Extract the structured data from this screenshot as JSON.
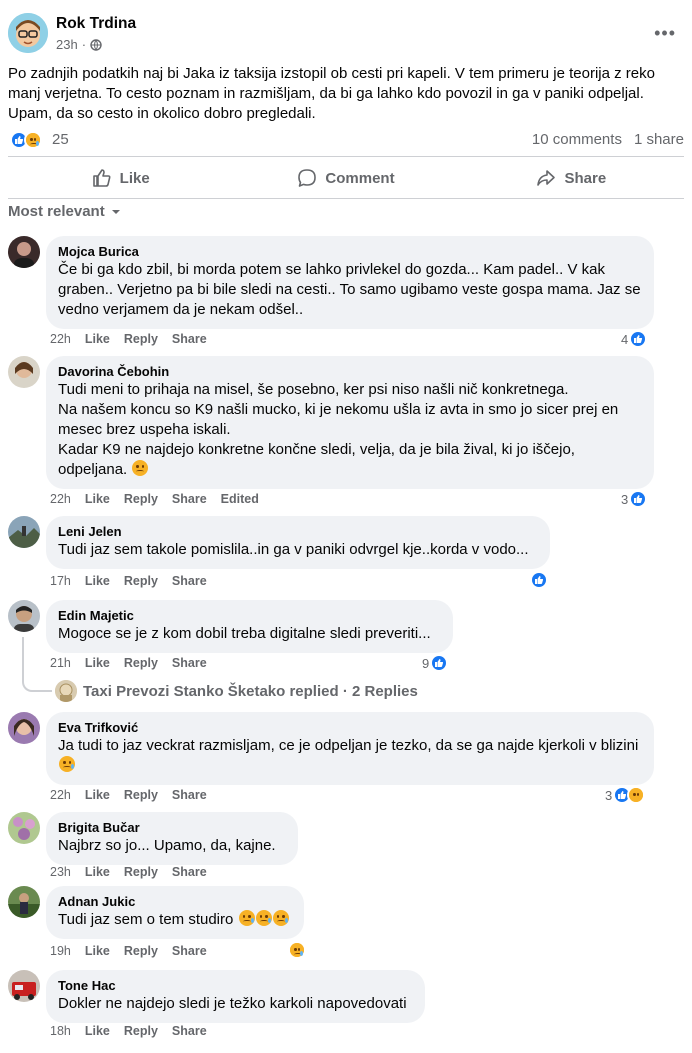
{
  "post": {
    "author": "Rok Trdina",
    "time": "23h",
    "privacy_icon": "globe-icon",
    "text": "Po zadnjih podatkih naj bi Jaka iz taksija izstopil ob cesti pri kapeli. V tem primeru je teorija z reko manj verjetna. To cesto poznam in razmišljam, da bi ga lahko kdo povozil in ga v paniki odpeljal. Upam, da so cesto in okolico dobro pregledali.",
    "reaction_count": "25",
    "comments_count": "10 comments",
    "shares_count": "1 share"
  },
  "actions": {
    "like": "Like",
    "comment": "Comment",
    "share": "Share"
  },
  "sort_label": "Most relevant",
  "comment_actions": {
    "like": "Like",
    "reply": "Reply",
    "share": "Share",
    "edited": "Edited"
  },
  "comments": [
    {
      "name": "Mojca Burica",
      "text": "Če bi ga kdo zbil, bi morda potem se lahko privlekel do gozda... Kam padel.. V kak graben.. Verjetno pa bi bile sledi na cesti.. To samo ugibamo veste gospa mama. Jaz se vedno verjamem da je nekam odšel..",
      "time": "22h",
      "reactions": "4"
    },
    {
      "name": "Davorina Čebohin",
      "text": "Tudi meni to prihaja na misel, še posebno, ker psi niso našli nič konkretnega.\nNa našem koncu so K9 našli mucko, ki je nekomu ušla iz avta in smo jo sicer prej en mesec brez uspeha iskali.\nKadar K9 ne najdejo konkretne končne sledi, velja, da je bila žival, ki jo iščejo, odpeljana.",
      "time": "22h",
      "reactions": "3"
    },
    {
      "name": "Leni Jelen",
      "text": "Tudi jaz sem takole pomislila..in ga v paniki odvrgel kje..korda v vodo...",
      "time": "17h",
      "reactions": ""
    },
    {
      "name": "Edin Majetic",
      "text": "Mogoce se je z kom dobil treba digitalne sledi preveriti...",
      "time": "21h",
      "reactions": "9"
    },
    {
      "name": "Eva Trifković",
      "text": "Ja tudi to jaz veckrat razmisljam, ce je odpeljan je tezko, da se ga najde kjerkoli v blizini",
      "time": "22h",
      "reactions": "3"
    },
    {
      "name": "Brigita Bučar",
      "text": "Najbrz so jo... Upamo, da, kajne.",
      "time": "23h",
      "reactions": ""
    },
    {
      "name": "Adnan Jukic",
      "text": "Tudi jaz sem o tem studiro",
      "time": "19h",
      "reactions": ""
    },
    {
      "name": "Tone Hac",
      "text": "Dokler ne najdejo sledi je težko karkoli napovedovati",
      "time": "18h",
      "reactions": ""
    }
  ],
  "replies_summary": "Taxi Prevozi Stanko Šketako replied · 2 Replies",
  "colors": {
    "like_blue": "#1877f2",
    "sad_yellow": "#f7b125",
    "bubble_gray": "#f0f2f5",
    "meta_gray": "#65676b"
  }
}
